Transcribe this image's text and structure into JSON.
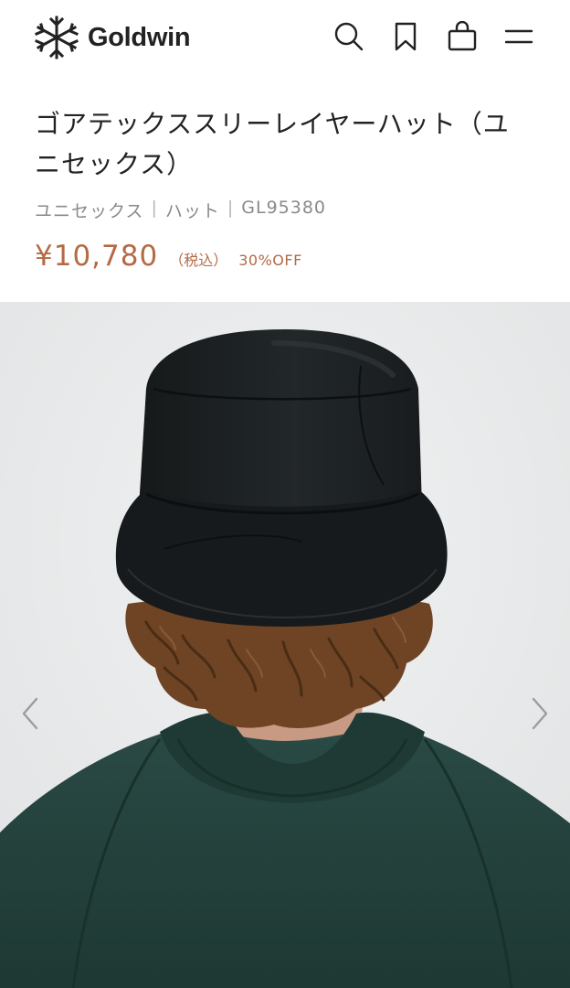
{
  "header": {
    "brand_name": "Goldwin",
    "icons": [
      "search-icon",
      "bookmark-icon",
      "shopping-bag-icon",
      "menu-icon"
    ]
  },
  "product": {
    "title_line1": "ゴアテックススリーレイヤーハット（ユ",
    "title_line2": "ニセックス）",
    "gender": "ユニセックス",
    "category": "ハット",
    "code": "GL95380",
    "separator": "|",
    "price": "¥10,780",
    "tax_label": "（税込）",
    "discount": "30%OFF"
  },
  "colors": {
    "price": "#b46a45",
    "meta": "#8a8a8a",
    "gallery_bg": "#e9eaeb",
    "hat": "#1b1e1e",
    "jacket": "#23413c",
    "hair": "#6e4424"
  },
  "gallery": {
    "prev_icon": "chevron-left-icon",
    "next_icon": "chevron-right-icon"
  }
}
